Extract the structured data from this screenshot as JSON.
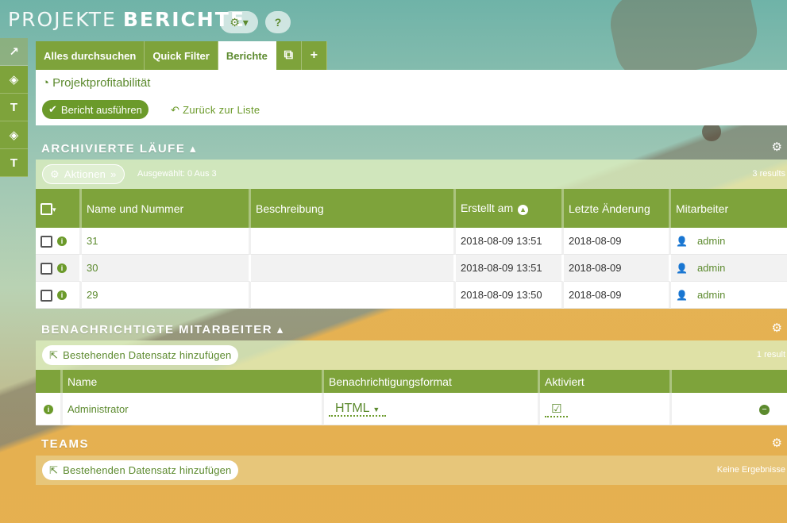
{
  "header": {
    "title_light": "PROJEKTE",
    "title_bold": "BERICHTE",
    "settings_label": "⚙ ▾",
    "help_label": "?"
  },
  "rail": [
    "↗",
    "◈",
    "T",
    "◈",
    "T"
  ],
  "tabs": {
    "search_all": "Alles durchsuchen",
    "quick_filter": "Quick Filter",
    "reports": "Berichte",
    "duplicate": "⧉",
    "add": "+"
  },
  "detail": {
    "title": "Projektprofitabilität",
    "run_button": "Bericht ausführen",
    "back_link": "Zurück zur Liste"
  },
  "archived": {
    "heading": "ARCHIVIERTE LÄUFE",
    "actions_label": "Aktionen",
    "selected_text": "Ausgewählt: 0 Aus 3",
    "results_text": "3 results",
    "columns": [
      "Name und Nummer",
      "Beschreibung",
      "Erstellt am",
      "Letzte Änderung",
      "Mitarbeiter"
    ],
    "rows": [
      {
        "name": "31",
        "description": "",
        "created": "2018-08-09 13:51",
        "modified": "2018-08-09",
        "user": "admin"
      },
      {
        "name": "30",
        "description": "",
        "created": "2018-08-09 13:51",
        "modified": "2018-08-09",
        "user": "admin"
      },
      {
        "name": "29",
        "description": "",
        "created": "2018-08-09 13:50",
        "modified": "2018-08-09",
        "user": "admin"
      }
    ]
  },
  "notified": {
    "heading": "BENACHRICHTIGTE MITARBEITER",
    "add_label": "Bestehenden Datensatz hinzufügen",
    "results_text": "1 result",
    "columns": [
      "Name",
      "Benachrichtigungsformat",
      "Aktiviert"
    ],
    "rows": [
      {
        "name": "Administrator",
        "format": "HTML",
        "enabled": true
      }
    ]
  },
  "teams": {
    "heading": "TEAMS",
    "add_label": "Bestehenden Datensatz hinzufügen",
    "results_text": "Keine Ergebnisse"
  },
  "colors": {
    "accent": "#7ea33b",
    "accent_dark": "#5c8a2e"
  }
}
